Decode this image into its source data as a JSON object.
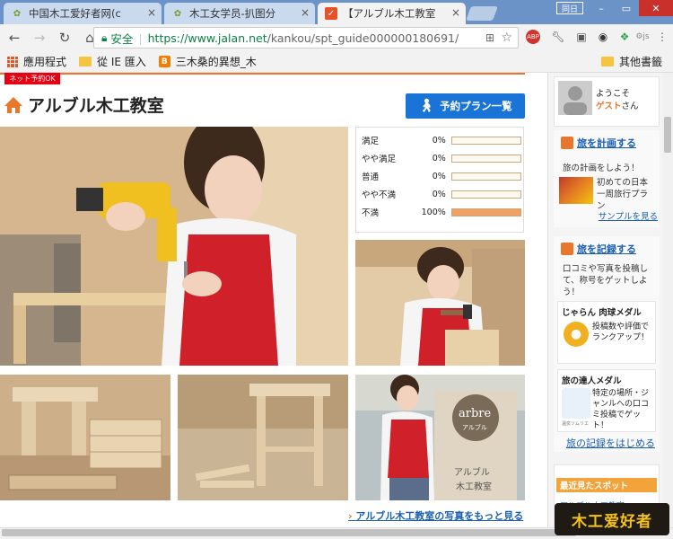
{
  "browser": {
    "tabs": [
      {
        "label": "中国木工爱好者网(c",
        "active": false
      },
      {
        "label": "木工女学员-扒图分",
        "active": false
      },
      {
        "label": "【アルブル木工教室",
        "active": true
      }
    ],
    "window_title_btn": "同日",
    "url_secure_label": "安全",
    "url_host": "https://www.jalan.net",
    "url_path": "/kankou/spt_guide000000180691/",
    "bookmarks": [
      {
        "label": "應用程式",
        "icon": "apps-grid-icon"
      },
      {
        "label": "從 IE 匯入",
        "icon": "folder-icon"
      },
      {
        "label": "三木桑的異想_木",
        "icon": "blogger-icon"
      }
    ],
    "other_bookmarks": "其他書籤"
  },
  "page": {
    "net_badge": "ネット予約OK",
    "title": "アルブル木工教室",
    "plan_button": "予約プラン一覧",
    "ratings": [
      {
        "label": "満足",
        "pct": "0%",
        "value": 0
      },
      {
        "label": "やや満足",
        "pct": "0%",
        "value": 0
      },
      {
        "label": "普通",
        "pct": "0%",
        "value": 0
      },
      {
        "label": "やや不満",
        "pct": "0%",
        "value": 0
      },
      {
        "label": "不満",
        "pct": "100%",
        "value": 100
      }
    ],
    "more_photos_link": "アルブル木工教室の写真をもっと見る",
    "sign_text": "arbre",
    "sign_sub": "アルブル",
    "sign_sub2": "アルブル",
    "sign_sub3": "木工教室"
  },
  "sidebar": {
    "welcome": "ようこそ",
    "guest": "ゲスト",
    "guest_suffix": "さん",
    "plan_head": "旅を計画する",
    "plan_text": "旅の計画をしよう！",
    "plan_sample_title": "初めての日本一周旅行プラン",
    "sample_link": "サンプルを見る",
    "record_head": "旅を記録する",
    "record_text": "口コミや写真を投稿して、称号をゲットしよう！",
    "medal1_title": "じゃらん 肉球メダル",
    "medal1_text": "投稿数や評価でランクアップ！",
    "medal2_title": "旅の達人メダル",
    "medal2_text": "特定の場所・ジャンルへの口コミ投稿でゲット！",
    "medal2_badge": "温泉ソムリエ",
    "record_link": "旅の記録をはじめる",
    "recent_head": "最近見たスポット",
    "recent_item": "アルブル木工教室"
  },
  "watermark": "木工爱好者",
  "colors": {
    "accent": "#e8762c",
    "link": "#1a5fb4",
    "button": "#1a74d8",
    "badge": "#e60012"
  }
}
